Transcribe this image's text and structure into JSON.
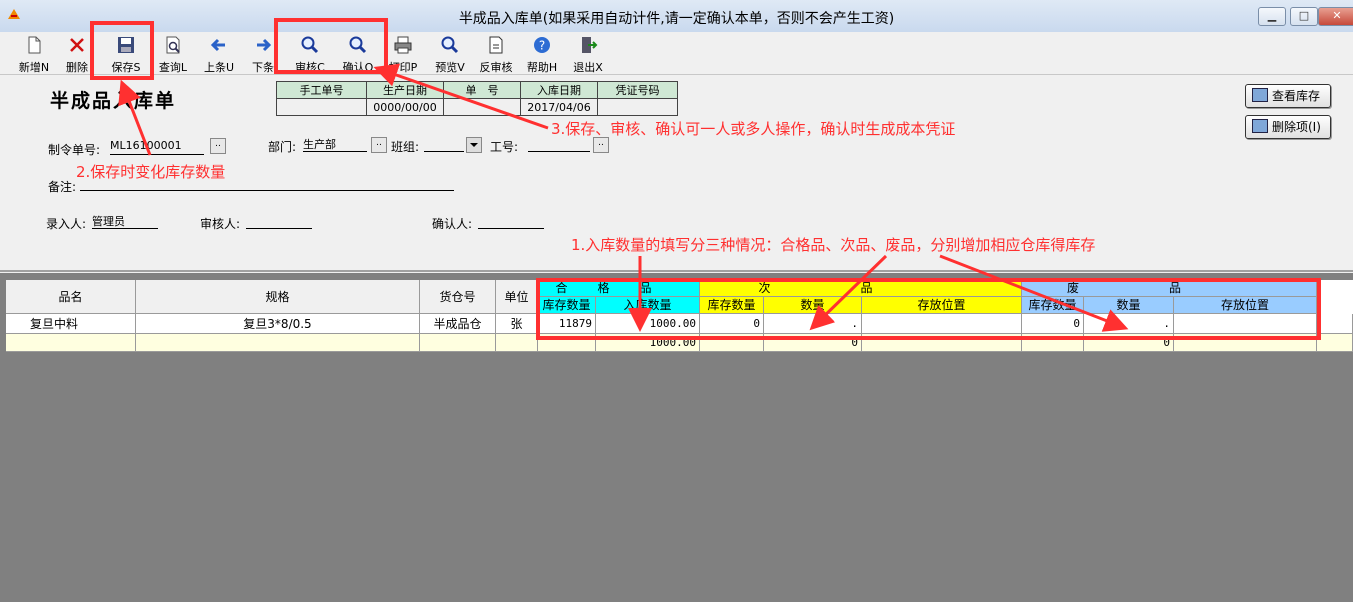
{
  "window": {
    "title": "半成品入库单(如果采用自动计件,请一定确认本单，否则不会产生工资)",
    "min": "▁",
    "max": "□",
    "close": "✕"
  },
  "toolbar": [
    {
      "id": "new",
      "label": "新增N",
      "icon": "new-doc-icon"
    },
    {
      "id": "delete",
      "label": "删除",
      "icon": "delete-x-icon"
    },
    {
      "id": "save",
      "label": "保存S",
      "icon": "floppy-disk-icon"
    },
    {
      "id": "query",
      "label": "查询L",
      "icon": "document-search-icon"
    },
    {
      "id": "prev",
      "label": "上条U",
      "icon": "arrow-left-icon"
    },
    {
      "id": "next",
      "label": "下条",
      "icon": "arrow-right-icon"
    },
    {
      "id": "audit",
      "label": "审核C",
      "icon": "magnifier-icon"
    },
    {
      "id": "confirm",
      "label": "确认Q",
      "icon": "magnifier-icon"
    },
    {
      "id": "print",
      "label": "打印P",
      "icon": "printer-icon"
    },
    {
      "id": "preview",
      "label": "预览V",
      "icon": "magnifier-icon"
    },
    {
      "id": "unaudit",
      "label": "反审核",
      "icon": "document-undo-icon"
    },
    {
      "id": "help",
      "label": "帮助H",
      "icon": "help-icon"
    },
    {
      "id": "exit",
      "label": "退出X",
      "icon": "exit-icon"
    }
  ],
  "form": {
    "heading": "半成品入库单",
    "header_table": {
      "columns": [
        "手工单号",
        "生产日期",
        "单　号",
        "入库日期",
        "凭证号码"
      ],
      "values": [
        "",
        "0000/00/00",
        "",
        "2017/04/06",
        ""
      ]
    },
    "order_no_label": "制令单号:",
    "order_no_value": "ML16100001",
    "dept_label": "部门:",
    "dept_value": "生产部",
    "team_label": "班组:",
    "team_value": "",
    "worker_label": "工号:",
    "worker_value": "",
    "remark_label": "备注:",
    "remark_value": "",
    "entered_by_label": "录入人:",
    "entered_by_value": "管理员",
    "auditor_label": "审核人:",
    "auditor_value": "",
    "confirmer_label": "确认人:",
    "confirmer_value": "",
    "ellipsis": "..",
    "btn_view_stock": "查看库存",
    "btn_delete_item": "删除项(I)"
  },
  "grid": {
    "group_headers": {
      "good": "合格品",
      "second": "次品",
      "waste": "废品"
    },
    "columns": [
      "品名",
      "规格",
      "货仓号",
      "单位",
      "库存数量",
      "入库数量",
      "库存数量",
      "数量",
      "存放位置",
      "库存数量",
      "数量",
      "存放位置"
    ],
    "rows": [
      [
        "复旦中料",
        "复旦3*8/0.5",
        "半成品仓",
        "张",
        "11879",
        "1000.00",
        "0",
        ".",
        "",
        "0",
        ".",
        ""
      ]
    ],
    "totals": [
      "",
      "",
      "",
      "",
      "",
      "1000.00",
      "",
      "0",
      "",
      "",
      "0",
      ""
    ]
  },
  "annotations": {
    "note1": "1.入库数量的填写分三种情况：合格品、次品、废品，分别增加相应仓库得库存",
    "note2": "2.保存时变化库存数量",
    "note3": "3.保存、审核、确认可一人或多人操作，确认时生成成本凭证"
  },
  "colors": {
    "annotation_red": "#ff3030",
    "good_header": "#00ffff",
    "second_header": "#ffff00",
    "waste_header": "#99ccff",
    "total_row": "#ffffe0"
  }
}
